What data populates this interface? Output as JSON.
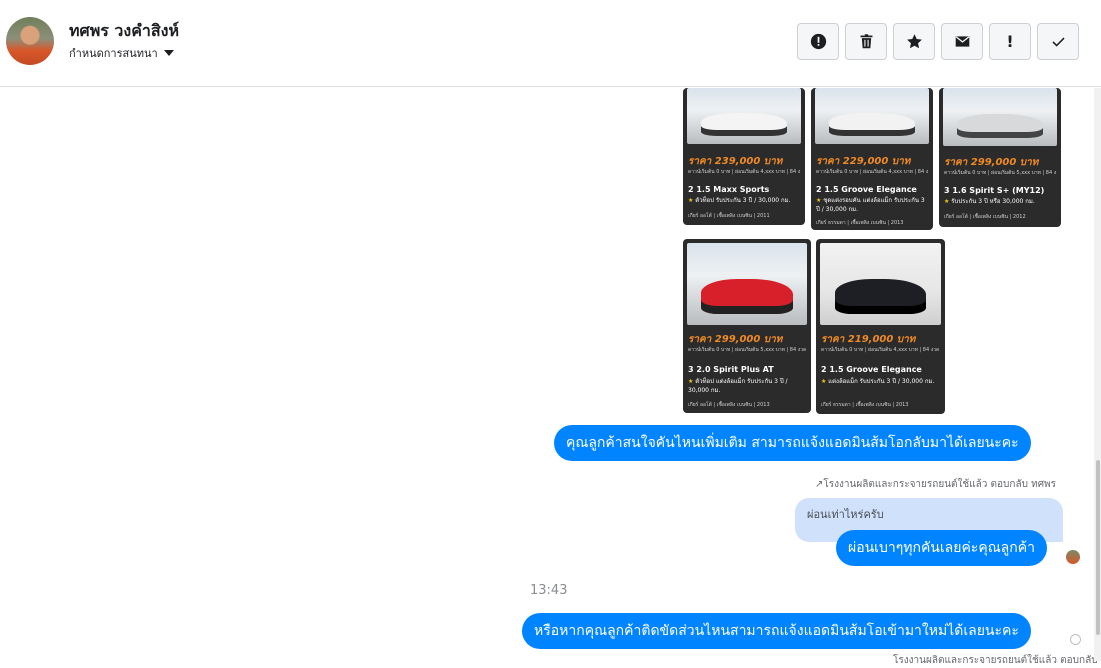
{
  "header": {
    "name": "ทศพร วงคำสิงห์",
    "subtitle": "กำหนดการสนทนา",
    "toolbar": [
      {
        "name": "alert-icon",
        "glyph": "!"
      },
      {
        "name": "trash-icon",
        "glyph": ""
      },
      {
        "name": "star-icon",
        "glyph": ""
      },
      {
        "name": "mail-icon",
        "glyph": ""
      },
      {
        "name": "exclamation-icon",
        "glyph": "!"
      },
      {
        "name": "check-icon",
        "glyph": ""
      }
    ]
  },
  "cars": [
    {
      "price": "ราคา 239,000 บาท",
      "model": "2 1.5 Maxx Sports",
      "note": "ตัวท็อป รับประกัน 3 ปี / 30,000 กม.",
      "foot": "เกียร์ ออโต้ | เชื้อเพลิง เบนซิน | 2011"
    },
    {
      "price": "ราคา 229,000 บาท",
      "model": "2 1.5 Groove Elegance",
      "note": "ชุดแต่งรอบคัน แต่งล้อแม็ก รับประกัน 3 ปี / 30,000 กม.",
      "foot": "เกียร์ ธรรมดา | เชื้อเพลิง เบนซิน | 2013"
    },
    {
      "price": "ราคา 299,000 บาท",
      "model": "3 1.6 Spirit S+ (MY12)",
      "note": "รับประกัน 3 ปี หรือ 30,000 กม.",
      "foot": "เกียร์ ออโต้ | เชื้อเพลิง เบนซิน | 2012"
    },
    {
      "price": "ราคา 299,000 บาท",
      "model": "3 2.0 Spirit Plus AT",
      "note": "ตัวท็อป แต่งล้อแม็ก รับประกัน 3 ปี / 30,000 กม.",
      "foot": "เกียร์ ออโต้ | เชื้อเพลิง เบนซิน | 2013"
    },
    {
      "price": "ราคา 219,000 บาท",
      "model": "2 1.5 Groove Elegance",
      "note": "แต่งล้อแม็ก รับประกัน 3 ปี / 30,000 กม.",
      "foot": "เกียร์ ธรรมดา | เชื้อเพลิง เบนซิน | 2013"
    }
  ],
  "messages": {
    "m1": "คุณลูกค้าสนใจคันไหนเพิ่มเติม สามารถแจ้งแอดมินส้มโอกลับมาได้เลยนะคะ",
    "reply_meta": "โรงงานผลิตและกระจายรถยนต์ใช้แล้ว ตอบกลับ ทศพร",
    "reply_quote": "ผ่อนเท่าไหร่ครับ",
    "m2": "ผ่อนเบาๆทุกคันเลยค่ะคุณลูกค้า",
    "time": "13:43",
    "m3": "หรือหากคุณลูกค้าติดขัดส่วนไหนสามารถแจ้งแอดมินส้มโอเข้ามาใหม่ได้เลยนะคะ",
    "bottom_meta": "โรงงานผลิตและกระจายรถยนต์ใช้แล้ว ตอบกลับ"
  }
}
